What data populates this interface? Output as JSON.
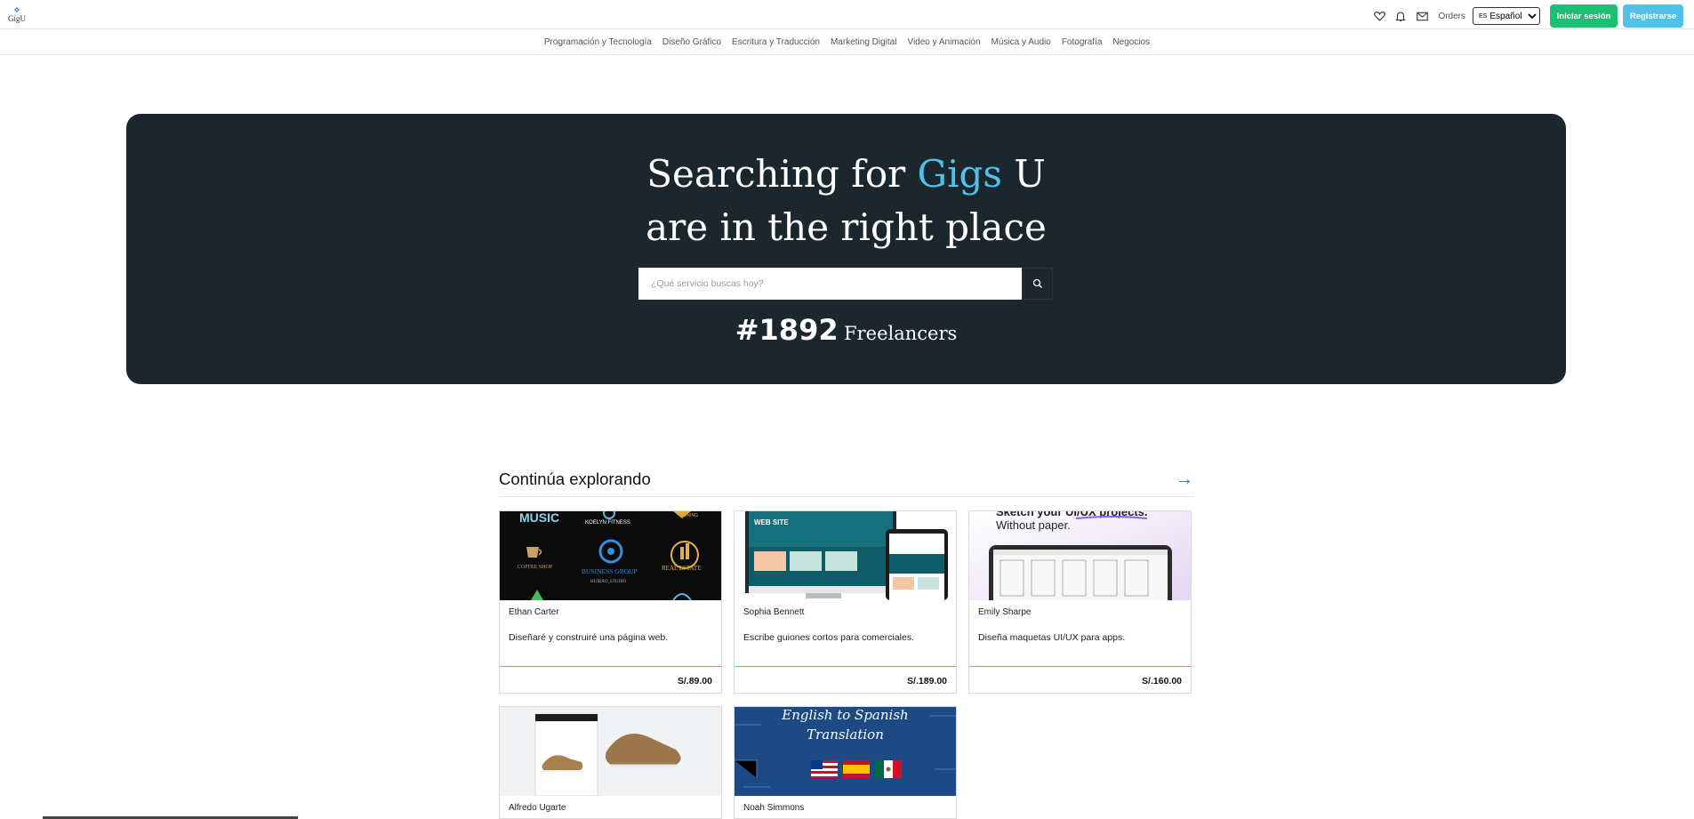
{
  "header": {
    "logo_text": "GigU",
    "orders_label": "Orders",
    "language_code": "ES",
    "language_label": "Español",
    "login_label": "Iniciar sesión",
    "register_label": "Registrarse",
    "icons": [
      "heart-icon",
      "bell-icon",
      "mail-icon"
    ]
  },
  "categories": [
    "Programación y Tecnología",
    "Diseño Gráfico",
    "Escritura y Traducción",
    "Marketing Digital",
    "Video y Animación",
    "Música y Audio",
    "Fotografía",
    "Negocios"
  ],
  "hero": {
    "title_pre": "Searching for ",
    "title_accent": "Gigs",
    "title_post": " U",
    "title_line2": "are in the right place",
    "search_placeholder": "¿Qué servicio buscas hoy?",
    "freelancer_count": "#1892",
    "freelancer_label": "Freelancers"
  },
  "explore": {
    "title": "Continúa explorando",
    "arrow": "→",
    "cards": [
      {
        "seller": "Ethan Carter",
        "description": "Diseñaré y construiré una página web.",
        "price": "S/.89.00",
        "thumb_texts": [
          "MUSIC",
          "KOELYN FITNESS",
          "COFFEE SHOP",
          "BUSINESS GROUP",
          "REAL ESTATE",
          "HUIRAO_STUDIO",
          "MINING"
        ]
      },
      {
        "seller": "Sophia Bennett",
        "description": "Escribe guiones cortos para comerciales.",
        "price": "S/.189.00",
        "thumb_texts": [
          "WEB SITE"
        ]
      },
      {
        "seller": "Emily Sharpe",
        "description": "Diseña maquetas UI/UX para apps.",
        "price": "S/.160.00",
        "thumb_texts": [
          "Sketch your UI/UX projects.",
          "Without paper."
        ]
      },
      {
        "seller": "Alfredo Ugarte",
        "description": "",
        "price": ""
      },
      {
        "seller": "Noah Simmons",
        "description": "",
        "price": "",
        "thumb_texts": [
          "English to Spanish",
          "Translation"
        ]
      }
    ]
  },
  "colors": {
    "hero_bg": "#1b272d",
    "accent": "#52c1ea",
    "login_green": "#1dbf73",
    "arrow_blue": "#1e73d0"
  }
}
